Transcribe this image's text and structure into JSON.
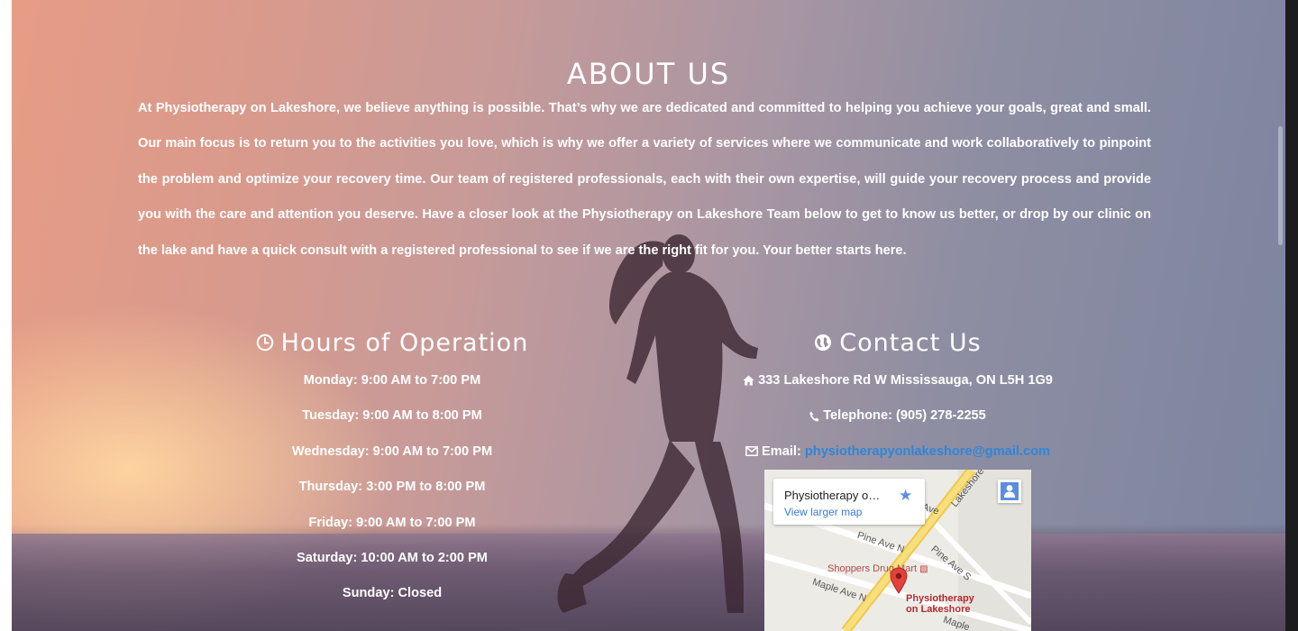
{
  "about": {
    "title": "ABOUT US",
    "paragraph": "At Physiotherapy on Lakeshore, we believe anything is possible. That’s why we are dedicated and committed to helping you achieve your goals, great and small. Our main focus is to return you to the activities you love, which is why we offer a variety of services where we communicate and work collaboratively to pinpoint the problem and optimize your recovery time. Our team of registered professionals, each with their own expertise, will guide your recovery process and provide you with the care and attention you deserve. Have a closer look at the Physiotherapy on Lakeshore Team below to get to know us better, or drop by our clinic on the lake and have a quick consult with a registered professional to see if we are the right fit for you. Your better starts here."
  },
  "hours": {
    "title": "Hours of Operation",
    "icon": "clock-icon",
    "days": [
      "Monday: 9:00 AM to 7:00 PM",
      "Tuesday: 9:00 AM to 8:00 PM",
      "Wednesday: 9:00 AM to 7:00 PM",
      "Thursday: 3:00 PM to 8:00 PM",
      "Friday: 9:00 AM to 7:00 PM",
      "Saturday: 10:00 AM to 2:00 PM",
      "Sunday: Closed"
    ]
  },
  "contact": {
    "title": "Contact Us",
    "icon": "globe-icon",
    "address": "333 Lakeshore Rd W Mississauga, ON L5H 1G9",
    "telephone": "Telephone: (905) 278-2255",
    "email_label": "Email:",
    "email": "physiotherapyonlakeshore@gmail.com",
    "link_color": "#2f86d6"
  },
  "map": {
    "place_name": "Physiotherapy o…",
    "view_larger": "View larger map",
    "streets": [
      "Lakeshore",
      "Ave",
      "Pine Ave N",
      "Pine Ave S",
      "Maple Ave N",
      "Maple"
    ],
    "poi_store": "Shoppers Drug Mart",
    "pin_label_1": "Physiotherapy",
    "pin_label_2": "on Lakeshore"
  }
}
